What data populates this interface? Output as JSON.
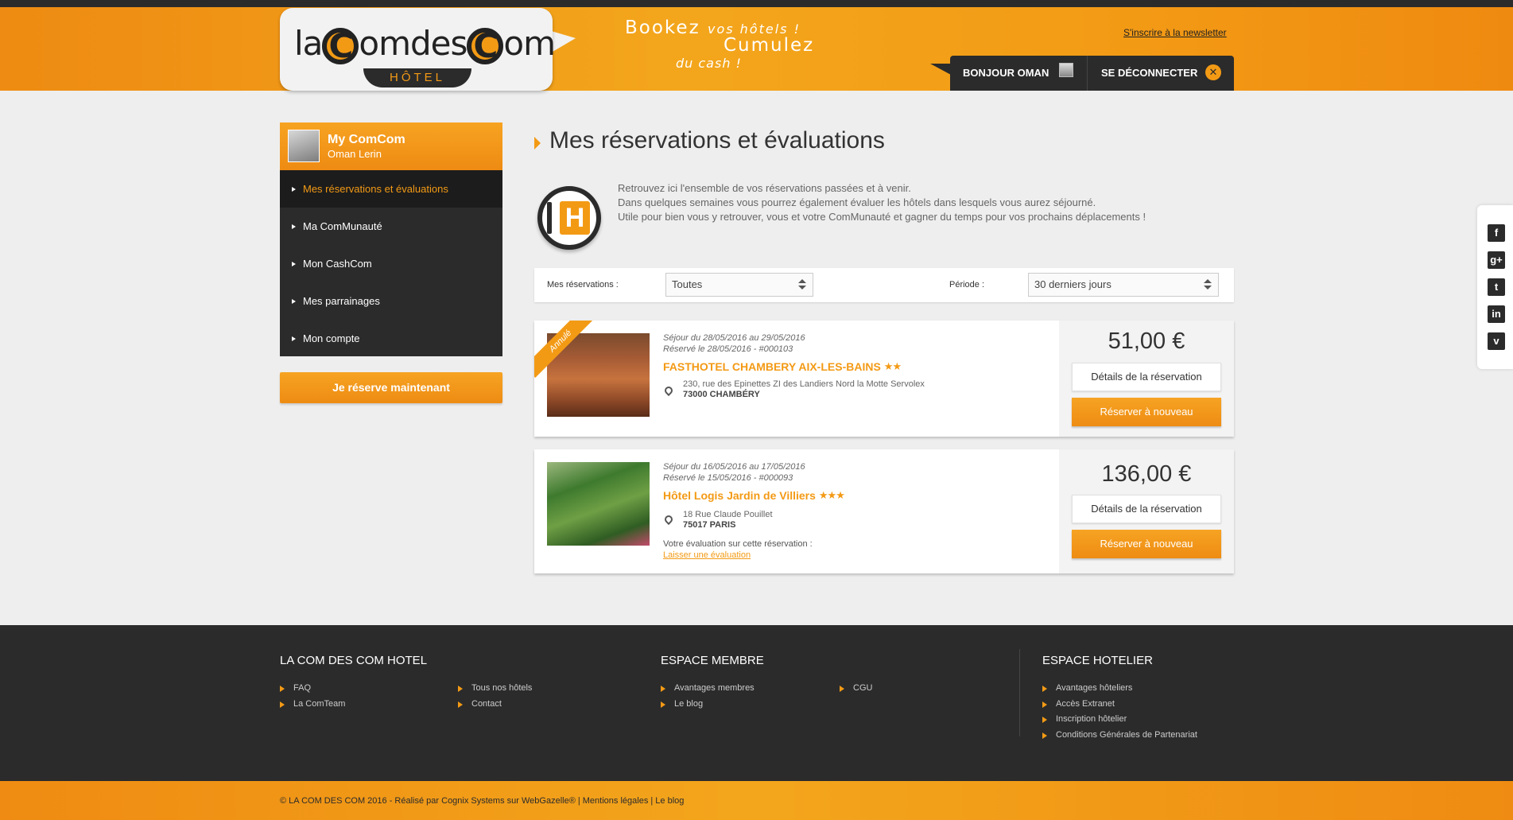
{
  "header": {
    "logo_text_1": "la",
    "logo_c1": "C",
    "logo_text_2": "omdes",
    "logo_c2": "C",
    "logo_text_3": "om",
    "logo_sub": "HÔTEL",
    "slogan_bookez": "Bookez",
    "slogan_vos_hotels": "vos hôtels !",
    "slogan_cumulez": "Cumulez",
    "slogan_du_cash": "du cash !",
    "newsletter_link": "S'inscrire à la newsletter",
    "hello": "BONJOUR OMAN",
    "logout": "SE DÉCONNECTER"
  },
  "sidebar": {
    "title": "My ComCom",
    "user": "Oman Lerin",
    "items": [
      {
        "label": "Mes réservations et évaluations"
      },
      {
        "label": "Ma ComMunauté"
      },
      {
        "label": "Mon CashCom"
      },
      {
        "label": "Mes parrainages"
      },
      {
        "label": "Mon compte"
      }
    ],
    "cta": "Je réserve maintenant"
  },
  "main": {
    "title": "Mes réservations et évaluations",
    "intro": [
      "Retrouvez ici l'ensemble de vos réservations passées et à venir.",
      "Dans quelques semaines vous pourrez également évaluer les hôtels dans lesquels vous aurez séjourné.",
      "Utile pour bien vous y retrouver, vous et votre ComMunauté et gagner du temps pour vos prochains déplacements !"
    ],
    "filters": {
      "reservations_label": "Mes réservations :",
      "reservations_value": "Toutes",
      "period_label": "Période :",
      "period_value": "30 derniers jours"
    },
    "bookings": [
      {
        "ribbon": "Annulé",
        "stay": "Séjour du 28/05/2016 au 29/05/2016",
        "booked": "Réservé le 28/05/2016 - #000103",
        "hotel": "FASTHOTEL CHAMBERY AIX-LES-BAINS",
        "stars": "★★",
        "address": "230, rue des Epinettes ZI des Landiers Nord la Motte Servolex",
        "city": "73000 CHAMBÉRY",
        "price": "51,00 €",
        "details_btn": "Détails de la réservation",
        "rebook_btn": "Réserver à nouveau"
      },
      {
        "stay": "Séjour du 16/05/2016 au 17/05/2016",
        "booked": "Réservé le 15/05/2016 - #000093",
        "hotel": "Hôtel Logis Jardin de Villiers",
        "stars": "★★★",
        "address": "18 Rue Claude Pouillet",
        "city": "75017 PARIS",
        "eval_label": "Votre évaluation sur cette réservation :",
        "eval_link": "Laisser une évaluation",
        "price": "136,00 €",
        "details_btn": "Détails de la réservation",
        "rebook_btn": "Réserver à nouveau"
      }
    ]
  },
  "social": [
    {
      "icon": "facebook-icon",
      "glyph": "f"
    },
    {
      "icon": "google-plus-icon",
      "glyph": "g+"
    },
    {
      "icon": "twitter-icon",
      "glyph": "t"
    },
    {
      "icon": "linkedin-icon",
      "glyph": "in"
    },
    {
      "icon": "viadeo-icon",
      "glyph": "v"
    }
  ],
  "footer": {
    "col1_title": "LA COM DES COM HOTEL",
    "col1_links": [
      "FAQ",
      "La ComTeam",
      "Tous nos hôtels",
      "Contact"
    ],
    "col2_title": "ESPACE MEMBRE",
    "col2_links": [
      "Avantages membres",
      "Le blog",
      "CGU"
    ],
    "col3_title": "ESPACE HOTELIER",
    "col3_links": [
      "Avantages hôteliers",
      "Accès Extranet",
      "Inscription hôtelier",
      "Conditions Générales de Partenariat"
    ],
    "copyright": "© LA COM DES COM 2016 - Réalisé par Cognix Systems sur WebGazelle® | Mentions légales | Le blog"
  },
  "colors": {
    "accent": "#f39a15",
    "dark": "#2b2b2b",
    "background": "#eeeeee"
  }
}
